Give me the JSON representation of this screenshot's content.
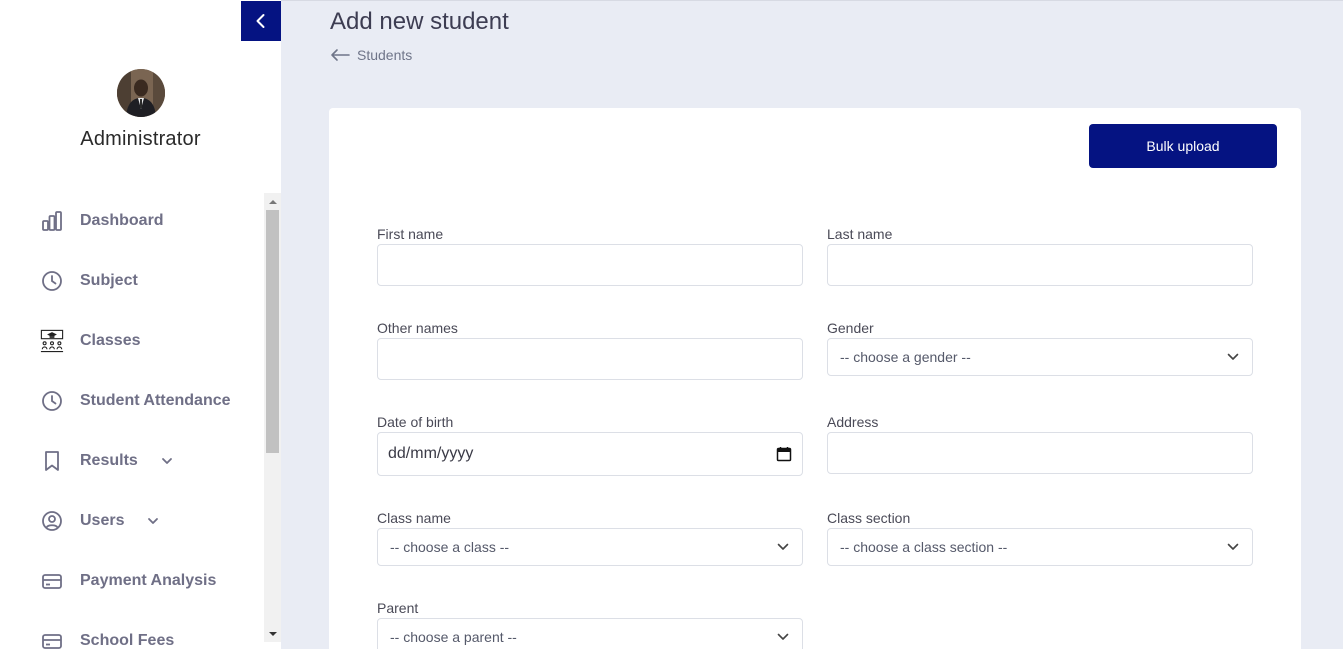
{
  "sidebar": {
    "user_name": "Administrator",
    "items": [
      {
        "label": "Dashboard",
        "icon": "bar-chart-icon"
      },
      {
        "label": "Subject",
        "icon": "clock-icon"
      },
      {
        "label": "Classes",
        "icon": "classroom-icon"
      },
      {
        "label": "Student Attendance",
        "icon": "clock-icon"
      },
      {
        "label": "Results",
        "icon": "bookmark-icon"
      },
      {
        "label": "Users",
        "icon": "user-circle-icon"
      },
      {
        "label": "Payment Analysis",
        "icon": "credit-card-icon"
      },
      {
        "label": "School Fees",
        "icon": "credit-card-icon"
      }
    ]
  },
  "header": {
    "title": "Add new student",
    "breadcrumb": "Students"
  },
  "form": {
    "bulk_upload": "Bulk upload",
    "first_name": {
      "label": "First name",
      "value": ""
    },
    "last_name": {
      "label": "Last name",
      "value": ""
    },
    "other_names": {
      "label": "Other names",
      "value": ""
    },
    "gender": {
      "label": "Gender",
      "selected": "-- choose a gender --"
    },
    "date_of_birth": {
      "label": "Date of birth",
      "placeholder": "dd/mm/yyyy"
    },
    "address": {
      "label": "Address",
      "value": ""
    },
    "class_name": {
      "label": "Class name",
      "selected": "-- choose a class --"
    },
    "class_section": {
      "label": "Class section",
      "selected": "-- choose a class section --"
    },
    "parent": {
      "label": "Parent",
      "selected": "-- choose a parent --"
    }
  },
  "colors": {
    "primary": "#051382",
    "background": "#e9ecf4",
    "menu_text": "#6f6f86"
  }
}
